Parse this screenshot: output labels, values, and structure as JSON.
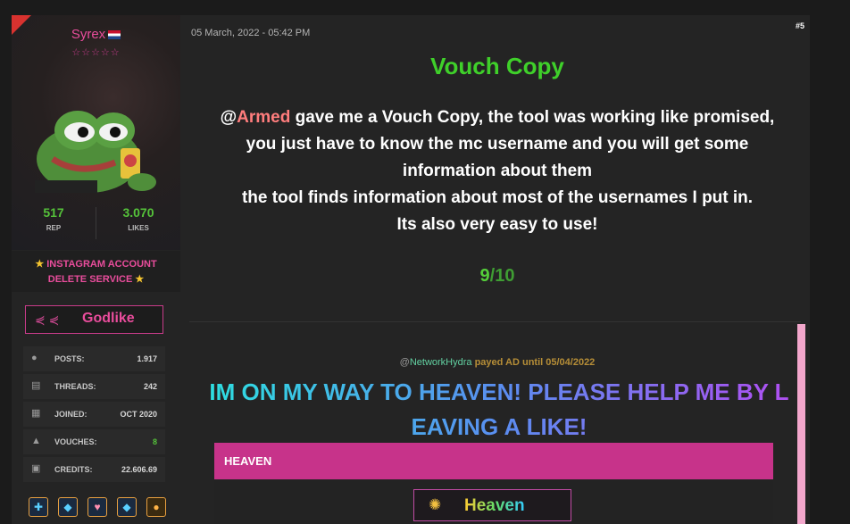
{
  "user": {
    "name": "Syrex",
    "flag_icon": "netherlands-flag-icon",
    "stars": "☆☆☆☆☆",
    "avatar_icon": "pepe-frog-avatar"
  },
  "stats": {
    "rep_value": "517",
    "rep_label": "REP",
    "likes_value": "3.070",
    "likes_label": "LIKES"
  },
  "service": {
    "line1": "INSTAGRAM ACCOUNT",
    "line2": "DELETE SERVICE"
  },
  "rank": {
    "label": "Godlike"
  },
  "info": [
    {
      "icon": "chat-bubbles-icon",
      "key": "POSTS:",
      "value": "1.917"
    },
    {
      "icon": "document-icon",
      "key": "THREADS:",
      "value": "242"
    },
    {
      "icon": "calendar-icon",
      "key": "JOINED:",
      "value": "OCT 2020"
    },
    {
      "icon": "thumbs-up-icon",
      "key": "VOUCHES:",
      "value": "8"
    },
    {
      "icon": "money-stack-icon",
      "key": "CREDITS:",
      "value": "22.606.69"
    }
  ],
  "badges": [
    "plus-badge-icon",
    "diamond-badge-icon",
    "heart-hand-badge-icon",
    "diamond-badge-icon",
    "chat-badge-icon"
  ],
  "post": {
    "date": "05 March, 2022 - 05:42 PM",
    "number": "#5",
    "title": "Vouch Copy",
    "body_at": "@",
    "body_mention": "Armed",
    "body_line1": " gave me a Vouch Copy, the tool was working like promised,",
    "body_line2": "you just have to know the mc username and you will get some",
    "body_line3": "information about them",
    "body_line4": "the tool finds information about most of the usernames I put in.",
    "body_line5": "Its also very easy to use!",
    "rating_score": "9",
    "rating_total": "/10"
  },
  "ad": {
    "at": "@",
    "user": "NetworkHydra",
    "payed": " payed AD until ",
    "until": "05/04/2022",
    "headline_line1": "IM ON MY WAY TO HEAVEN! PLEASE HELP ME BY L",
    "headline_line2": "EAVING A LIKE!",
    "bar_title": "HEAVEN",
    "banner_text": "Heaven"
  },
  "colors": {
    "accent_pink": "#e94d9c",
    "green": "#3fd02a",
    "background": "#1b1b1b",
    "panel": "#242424"
  }
}
